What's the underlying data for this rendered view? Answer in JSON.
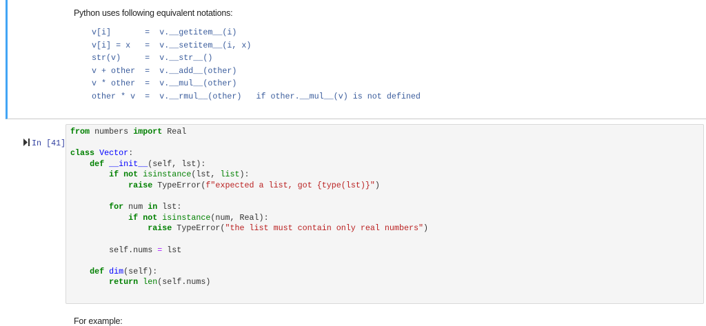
{
  "markdown_cell": {
    "intro": "Python uses following equivalent notations:",
    "notations": [
      "v[i]       =  v.__getitem__(i)",
      "v[i] = x   =  v.__setitem__(i, x)",
      "str(v)     =  v.__str__()",
      "v + other  =  v.__add__(other)",
      "v * other  =  v.__mul__(other)",
      "other * v  =  v.__rmul__(other)   if other.__mul__(v) is not defined"
    ],
    "accent_color": "#42a5f5"
  },
  "code_cell": {
    "prompt": "In [41]:",
    "run_icon": "run-cell-icon",
    "lines": [
      [
        [
          "from",
          "kw"
        ],
        [
          " numbers ",
          "tx"
        ],
        [
          "import",
          "kw"
        ],
        [
          " Real",
          "tx"
        ]
      ],
      [],
      [
        [
          "class",
          "kw"
        ],
        [
          " ",
          "tx"
        ],
        [
          "Vector",
          "nm"
        ],
        [
          ":",
          "tx"
        ]
      ],
      [
        [
          "    ",
          "tx"
        ],
        [
          "def",
          "kw"
        ],
        [
          " ",
          "tx"
        ],
        [
          "__init__",
          "nm"
        ],
        [
          "(self, lst):",
          "tx"
        ]
      ],
      [
        [
          "        ",
          "tx"
        ],
        [
          "if",
          "kw"
        ],
        [
          " ",
          "tx"
        ],
        [
          "not",
          "kw"
        ],
        [
          " ",
          "tx"
        ],
        [
          "isinstance",
          "bi"
        ],
        [
          "(lst, ",
          "tx"
        ],
        [
          "list",
          "bi"
        ],
        [
          "):",
          "tx"
        ]
      ],
      [
        [
          "            ",
          "tx"
        ],
        [
          "raise",
          "kw"
        ],
        [
          " TypeError(",
          "tx"
        ],
        [
          "f\"expected a list, got {type(lst)}\"",
          "st"
        ],
        [
          ")",
          "tx"
        ]
      ],
      [],
      [
        [
          "        ",
          "tx"
        ],
        [
          "for",
          "kw"
        ],
        [
          " num ",
          "tx"
        ],
        [
          "in",
          "kw"
        ],
        [
          " lst:",
          "tx"
        ]
      ],
      [
        [
          "            ",
          "tx"
        ],
        [
          "if",
          "kw"
        ],
        [
          " ",
          "tx"
        ],
        [
          "not",
          "kw"
        ],
        [
          " ",
          "tx"
        ],
        [
          "isinstance",
          "bi"
        ],
        [
          "(num, Real):",
          "tx"
        ]
      ],
      [
        [
          "                ",
          "tx"
        ],
        [
          "raise",
          "kw"
        ],
        [
          " TypeError(",
          "tx"
        ],
        [
          "\"the list must contain only real numbers\"",
          "st"
        ],
        [
          ")",
          "tx"
        ]
      ],
      [],
      [
        [
          "        self.nums ",
          "tx"
        ],
        [
          "=",
          "op"
        ],
        [
          " lst",
          "tx"
        ]
      ],
      [],
      [
        [
          "    ",
          "tx"
        ],
        [
          "def",
          "kw"
        ],
        [
          " ",
          "tx"
        ],
        [
          "dim",
          "nm"
        ],
        [
          "(self):",
          "tx"
        ]
      ],
      [
        [
          "        ",
          "tx"
        ],
        [
          "return",
          "kw"
        ],
        [
          " ",
          "tx"
        ],
        [
          "len",
          "bi"
        ],
        [
          "(self.nums)",
          "tx"
        ]
      ]
    ]
  },
  "next_markdown": {
    "text": "For example:"
  }
}
